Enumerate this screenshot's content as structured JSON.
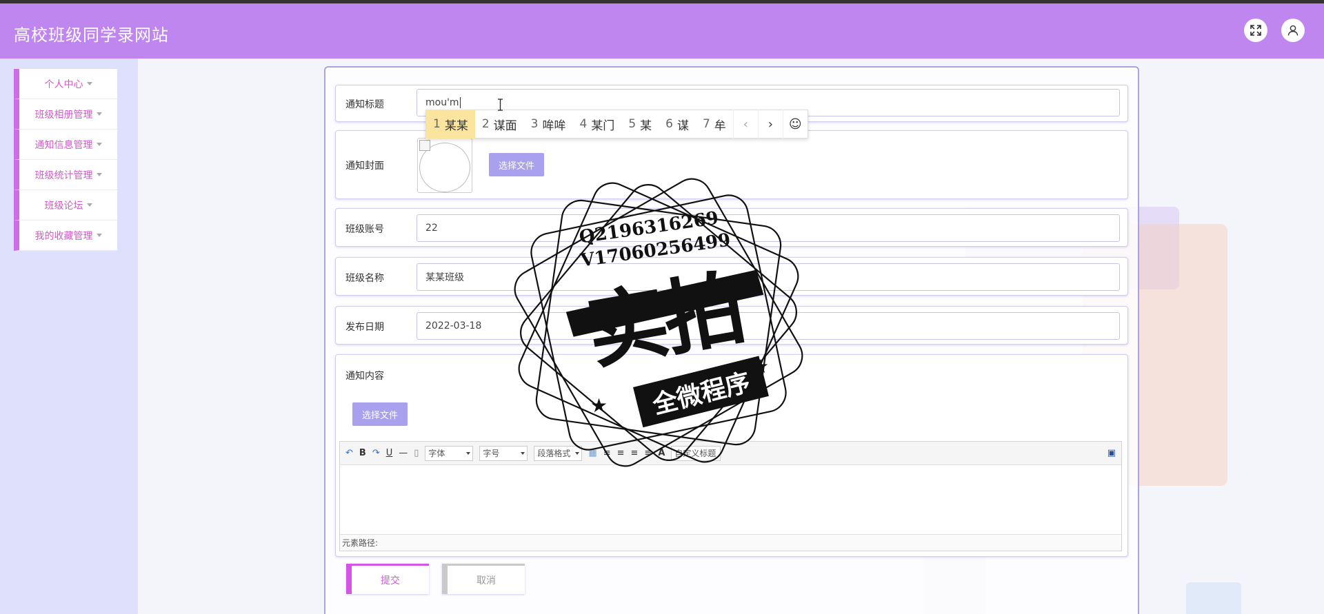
{
  "app": {
    "title": "高校班级同学录网站"
  },
  "header": {
    "fullscreen_icon": "expand-icon",
    "user_icon": "user-icon"
  },
  "sidebar": {
    "items": [
      {
        "label": "个人中心"
      },
      {
        "label": "班级相册管理"
      },
      {
        "label": "通知信息管理"
      },
      {
        "label": "班级统计管理"
      },
      {
        "label": "班级论坛"
      },
      {
        "label": "我的收藏管理"
      }
    ]
  },
  "form": {
    "title_label": "通知标题",
    "title_value": "mou'm",
    "cover_label": "通知封面",
    "cover_button": "选择文件",
    "account_label": "班级账号",
    "account_value": "22",
    "classname_label": "班级名称",
    "classname_value": "某某班级",
    "date_label": "发布日期",
    "date_value": "2022-03-18",
    "content_label": "通知内容",
    "content_button": "选择文件",
    "submit_label": "提交",
    "cancel_label": "取消"
  },
  "editor": {
    "font_select": "字体",
    "size_select": "字号",
    "paragraph_select": "段落格式",
    "custom_title": "自定义标题",
    "path_label": "元素路径:",
    "bold": "B",
    "underline": "U",
    "font_color": "A"
  },
  "ime": {
    "candidates": [
      {
        "num": "1",
        "text": "某某",
        "selected": true
      },
      {
        "num": "2",
        "text": "谋面"
      },
      {
        "num": "3",
        "text": "哞哞"
      },
      {
        "num": "4",
        "text": "某门"
      },
      {
        "num": "5",
        "text": "某"
      },
      {
        "num": "6",
        "text": "谋"
      },
      {
        "num": "7",
        "text": "牟"
      }
    ],
    "prev": "‹",
    "next": "›",
    "emoji": "☺"
  },
  "watermark": {
    "line1": "Q2196316269",
    "line2": "V17060256499",
    "main": "实拍",
    "banner": "全微程序"
  },
  "colors": {
    "header": "#bf86f0",
    "accent": "#cf6ce8",
    "button": "#a9a0ee"
  }
}
